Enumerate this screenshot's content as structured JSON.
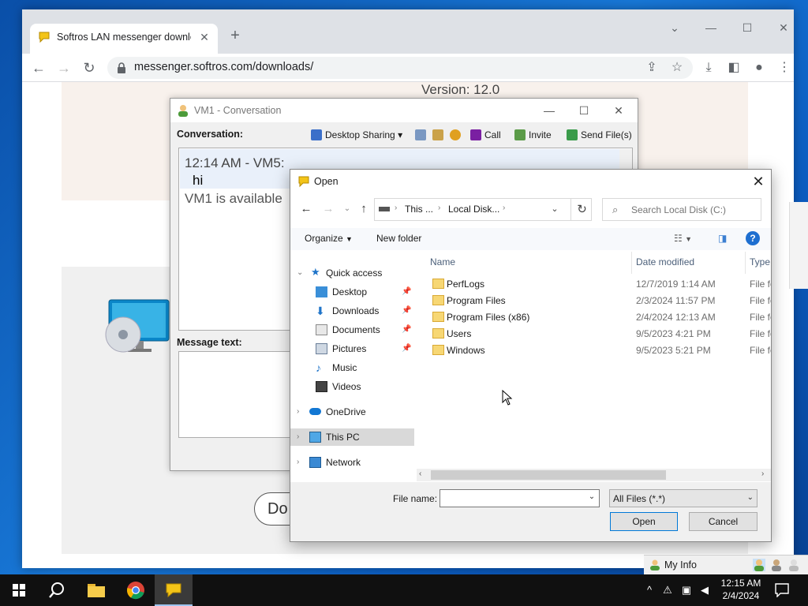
{
  "browser": {
    "tab_title": "Softros LAN messenger downlo",
    "url": "messenger.softros.com/downloads/",
    "page_version": "Version: 12.0",
    "download_button_partial": "Do"
  },
  "conversation": {
    "window_title": "VM1 - Conversation",
    "conversation_label": "Conversation:",
    "tools": {
      "desktop_sharing": "Desktop Sharing",
      "call": "Call",
      "invite": "Invite",
      "send_files": "Send File(s)"
    },
    "messages": {
      "header": "12:14 AM - VM5:",
      "text": "hi",
      "status": "VM1 is available"
    },
    "message_label": "Message text:"
  },
  "open_dialog": {
    "title": "Open",
    "breadcrumb": [
      "This ...",
      "Local Disk..."
    ],
    "search_placeholder": "Search Local Disk (C:)",
    "organize": "Organize",
    "new_folder": "New folder",
    "columns": {
      "name": "Name",
      "date": "Date modified",
      "type": "Type"
    },
    "nav": {
      "quick_access": "Quick access",
      "desktop": "Desktop",
      "downloads": "Downloads",
      "documents": "Documents",
      "pictures": "Pictures",
      "music": "Music",
      "videos": "Videos",
      "onedrive": "OneDrive",
      "this_pc": "This PC",
      "network": "Network"
    },
    "files": [
      {
        "name": "PerfLogs",
        "date": "12/7/2019 1:14 AM",
        "type": "File fo"
      },
      {
        "name": "Program Files",
        "date": "2/3/2024 11:57 PM",
        "type": "File fo"
      },
      {
        "name": "Program Files (x86)",
        "date": "2/4/2024 12:13 AM",
        "type": "File fo"
      },
      {
        "name": "Users",
        "date": "9/5/2023 4:21 PM",
        "type": "File fo"
      },
      {
        "name": "Windows",
        "date": "9/5/2023 5:21 PM",
        "type": "File fo"
      }
    ],
    "file_name_label": "File name:",
    "file_name_value": "",
    "filter": "All Files (*.*)",
    "open_button": "Open",
    "cancel_button": "Cancel"
  },
  "messenger_panel": {
    "my_info": "My Info"
  },
  "taskbar": {
    "time": "12:15 AM",
    "date": "2/4/2024"
  },
  "colors": {
    "accent": "#0078d7",
    "selection": "#d9d9d9",
    "taskbar": "#101010"
  }
}
